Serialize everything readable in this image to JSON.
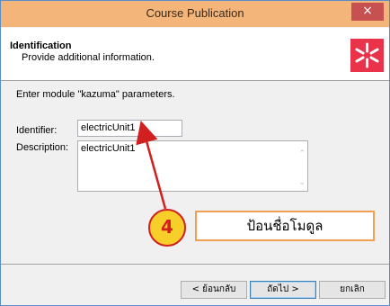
{
  "window": {
    "title": "Course Publication",
    "close_label": "×"
  },
  "header": {
    "title": "Identification",
    "subtitle": "Provide additional information."
  },
  "content": {
    "instruction": "Enter module \"kazuma\" parameters.",
    "identifier_label": "Identifier:",
    "identifier_value": "electricUnit1",
    "description_label": "Description:",
    "description_value": "electricUnit1"
  },
  "callout": {
    "step_number": "4",
    "text": "ป้อนชื่อโมดูล"
  },
  "buttons": {
    "back_label": "< ย้อนกลับ",
    "next_label": "ถัดไป >",
    "cancel_label": "ยกเลิก"
  },
  "colors": {
    "titlebar": "#f4b57a",
    "close": "#c75050",
    "logo": "#e8334a",
    "callout_border": "#d21f1f",
    "callout_fill": "#f8cf2a",
    "callout_box_border": "#f0a055"
  }
}
